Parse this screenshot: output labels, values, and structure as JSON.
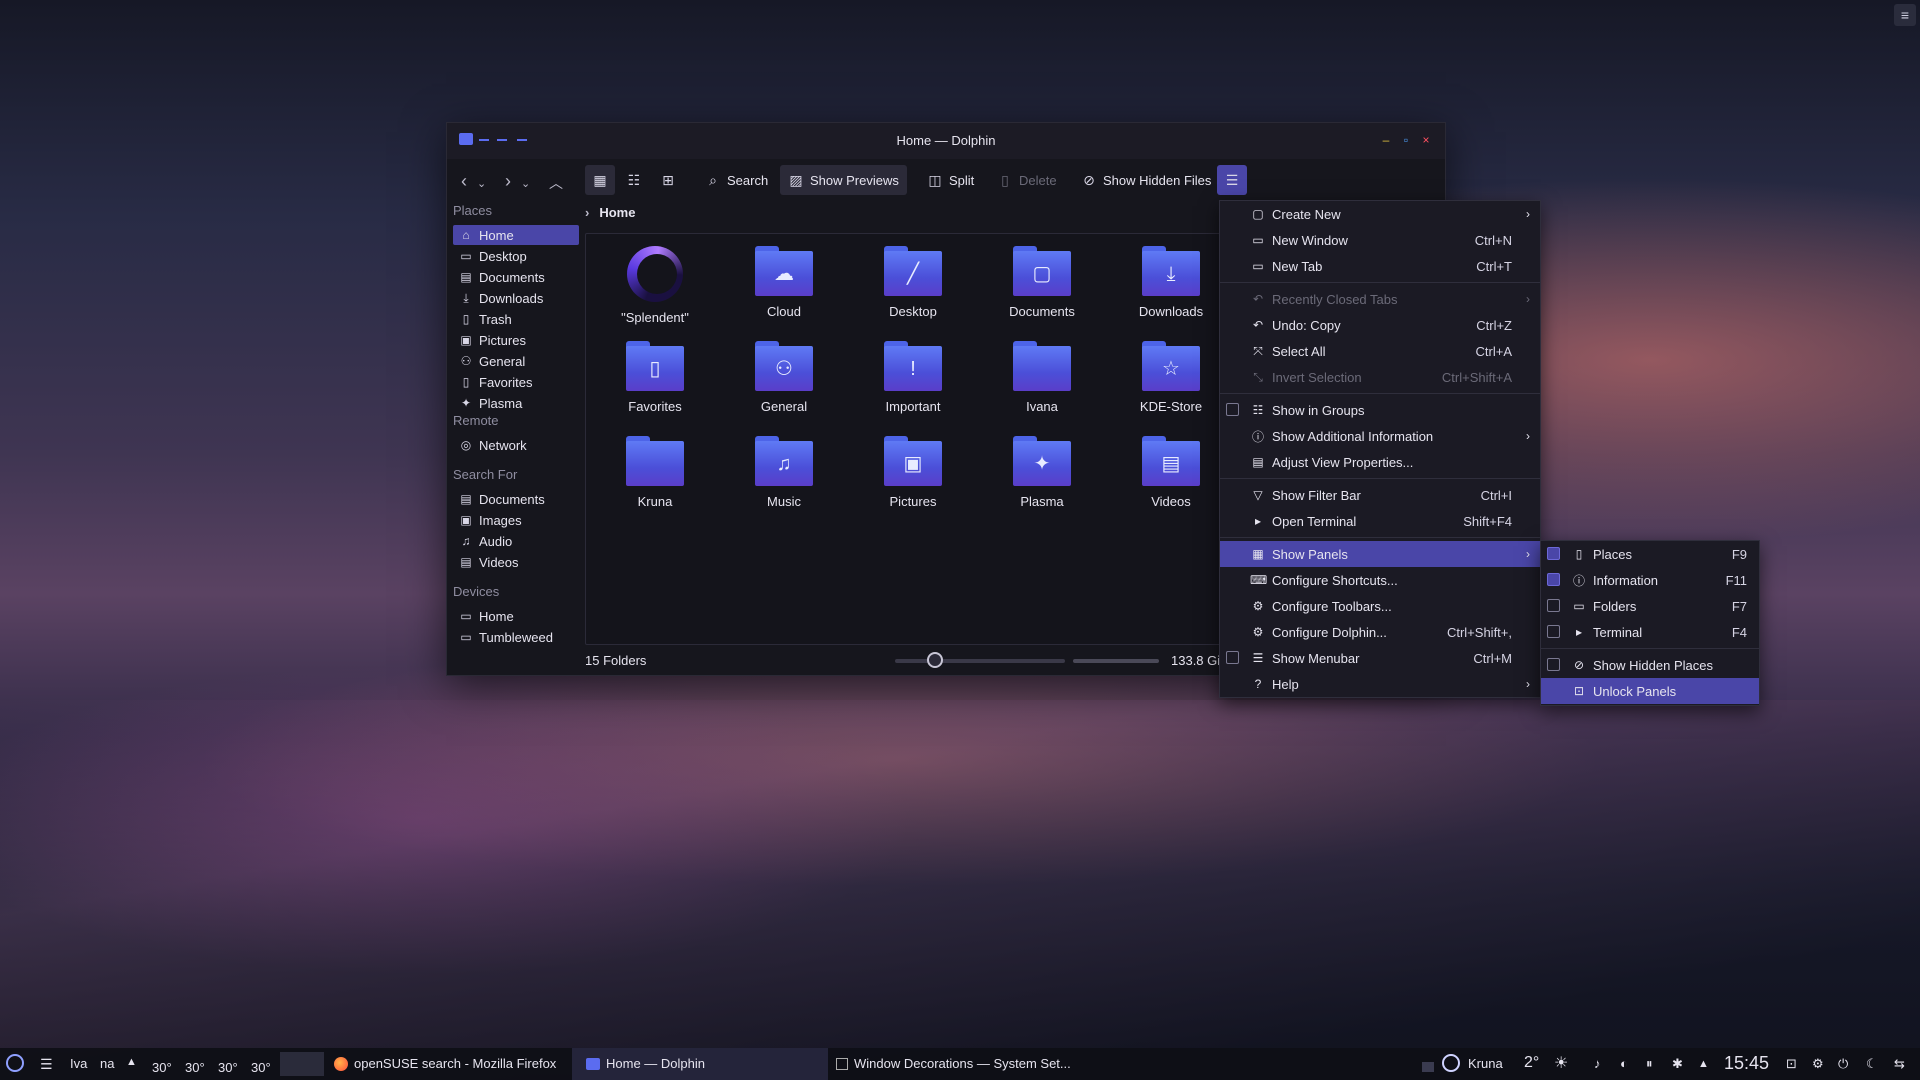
{
  "window": {
    "title": "Home — Dolphin",
    "minimize": "–",
    "maximize": "▫",
    "close": "×"
  },
  "toolbar": {
    "search": "Search",
    "show_previews": "Show Previews",
    "split": "Split",
    "delete": "Delete",
    "show_hidden": "Show Hidden Files"
  },
  "sidebar": {
    "places_title": "Places",
    "places": [
      {
        "label": "Home",
        "icon": "home-icon"
      },
      {
        "label": "Desktop",
        "icon": "desktop-icon"
      },
      {
        "label": "Documents",
        "icon": "documents-icon"
      },
      {
        "label": "Downloads",
        "icon": "downloads-icon"
      },
      {
        "label": "Trash",
        "icon": "trash-icon"
      },
      {
        "label": "Pictures",
        "icon": "pictures-icon"
      },
      {
        "label": "General",
        "icon": "general-icon"
      },
      {
        "label": "Favorites",
        "icon": "favorites-icon"
      },
      {
        "label": "Plasma",
        "icon": "plasma-icon"
      }
    ],
    "remote_title": "Remote",
    "remote": [
      {
        "label": "Network",
        "icon": "network-icon"
      }
    ],
    "search_title": "Search For",
    "search": [
      {
        "label": "Documents",
        "icon": "documents-icon"
      },
      {
        "label": "Images",
        "icon": "images-icon"
      },
      {
        "label": "Audio",
        "icon": "audio-icon"
      },
      {
        "label": "Videos",
        "icon": "videos-icon"
      }
    ],
    "devices_title": "Devices",
    "devices": [
      {
        "label": "Home",
        "icon": "drive-icon"
      },
      {
        "label": "Tumbleweed",
        "icon": "drive-icon"
      }
    ]
  },
  "breadcrumb": {
    "current": "Home"
  },
  "folders": [
    {
      "label": "\"Splendent\"",
      "glyph": ""
    },
    {
      "label": "Cloud",
      "glyph": "☁"
    },
    {
      "label": "Desktop",
      "glyph": "╱"
    },
    {
      "label": "Documents",
      "glyph": "▢"
    },
    {
      "label": "Downloads",
      "glyph": "⤓"
    },
    {
      "label": "Favorites",
      "glyph": "▯"
    },
    {
      "label": "General",
      "glyph": "⚇"
    },
    {
      "label": "Important",
      "glyph": "!"
    },
    {
      "label": "Ivana",
      "glyph": ""
    },
    {
      "label": "KDE-Store",
      "glyph": "☆"
    },
    {
      "label": "Kruna",
      "glyph": ""
    },
    {
      "label": "Music",
      "glyph": "♫"
    },
    {
      "label": "Pictures",
      "glyph": "▣"
    },
    {
      "label": "Plasma",
      "glyph": "✦"
    },
    {
      "label": "Videos",
      "glyph": "▤"
    }
  ],
  "status": {
    "count": "15 Folders",
    "free": "133.8 GiB"
  },
  "menu": {
    "items": [
      {
        "label": "Create New",
        "shortcut": "",
        "icon": "new-file-icon",
        "submenu": true,
        "disabled": false,
        "check": null
      },
      {
        "label": "New Window",
        "shortcut": "Ctrl+N",
        "icon": "window-icon",
        "submenu": false,
        "disabled": false,
        "check": null
      },
      {
        "label": "New Tab",
        "shortcut": "Ctrl+T",
        "icon": "tab-icon",
        "submenu": false,
        "disabled": false,
        "check": null
      },
      {
        "label": "Recently Closed Tabs",
        "shortcut": "",
        "icon": "undo-icon",
        "submenu": true,
        "disabled": true,
        "check": null
      },
      {
        "label": "Undo: Copy",
        "shortcut": "Ctrl+Z",
        "icon": "undo-icon",
        "submenu": false,
        "disabled": false,
        "check": null
      },
      {
        "label": "Select All",
        "shortcut": "Ctrl+A",
        "icon": "select-all-icon",
        "submenu": false,
        "disabled": false,
        "check": null
      },
      {
        "label": "Invert Selection",
        "shortcut": "Ctrl+Shift+A",
        "icon": "invert-icon",
        "submenu": false,
        "disabled": true,
        "check": null
      },
      {
        "label": "Show in Groups",
        "shortcut": "",
        "icon": "groups-icon",
        "submenu": false,
        "disabled": false,
        "check": false
      },
      {
        "label": "Show Additional Information",
        "shortcut": "",
        "icon": "info-icon",
        "submenu": true,
        "disabled": false,
        "check": null
      },
      {
        "label": "Adjust View Properties...",
        "shortcut": "",
        "icon": "properties-icon",
        "submenu": false,
        "disabled": false,
        "check": null
      },
      {
        "label": "Show Filter Bar",
        "shortcut": "Ctrl+I",
        "icon": "filter-icon",
        "submenu": false,
        "disabled": false,
        "check": null
      },
      {
        "label": "Open Terminal",
        "shortcut": "Shift+F4",
        "icon": "terminal-icon",
        "submenu": false,
        "disabled": false,
        "check": null
      },
      {
        "label": "Show Panels",
        "shortcut": "",
        "icon": "panels-icon",
        "submenu": true,
        "disabled": false,
        "check": null
      },
      {
        "label": "Configure Shortcuts...",
        "shortcut": "",
        "icon": "keyboard-icon",
        "submenu": false,
        "disabled": false,
        "check": null
      },
      {
        "label": "Configure Toolbars...",
        "shortcut": "",
        "icon": "configure-icon",
        "submenu": false,
        "disabled": false,
        "check": null
      },
      {
        "label": "Configure Dolphin...",
        "shortcut": "Ctrl+Shift+,",
        "icon": "configure-icon",
        "submenu": false,
        "disabled": false,
        "check": null
      },
      {
        "label": "Show Menubar",
        "shortcut": "Ctrl+M",
        "icon": "menubar-icon",
        "submenu": false,
        "disabled": false,
        "check": false
      },
      {
        "label": "Help",
        "shortcut": "",
        "icon": "help-icon",
        "submenu": true,
        "disabled": false,
        "check": null
      }
    ]
  },
  "panels_menu": {
    "items": [
      {
        "label": "Places",
        "shortcut": "F9",
        "icon": "bookmark-icon",
        "check": true
      },
      {
        "label": "Information",
        "shortcut": "F11",
        "icon": "info-icon",
        "check": true
      },
      {
        "label": "Folders",
        "shortcut": "F7",
        "icon": "folder-icon",
        "check": false
      },
      {
        "label": "Terminal",
        "shortcut": "F4",
        "icon": "terminal-icon",
        "check": false
      },
      {
        "label": "Show Hidden Places",
        "shortcut": "",
        "icon": "hidden-icon",
        "check": false
      },
      {
        "label": "Unlock Panels",
        "shortcut": "",
        "icon": "lock-icon",
        "check": null
      }
    ]
  },
  "taskbar": {
    "left_texts": [
      "Iva",
      "na"
    ],
    "temps": [
      "30°",
      "30°",
      "30°",
      "30°"
    ],
    "tasks": [
      {
        "label": "openSUSE search - Mozilla Firefox"
      },
      {
        "label": "Home — Dolphin"
      },
      {
        "label": "Window Decorations — System Set..."
      }
    ],
    "user": "Kruna",
    "weather": "2°",
    "clock": "15:45"
  },
  "colors": {
    "accent": "#4a46a8",
    "folder": "#5b6cf0"
  }
}
